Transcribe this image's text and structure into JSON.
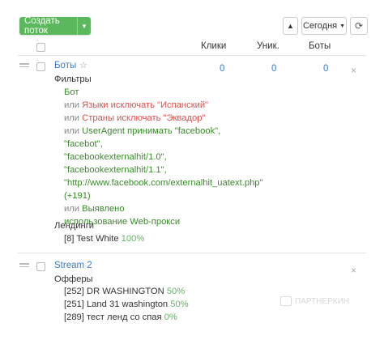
{
  "toolbar": {
    "create_label": "Создать поток",
    "period_label": "Сегодня"
  },
  "columns": {
    "clicks": "Клики",
    "unique": "Уник.",
    "bots": "Боты"
  },
  "streams": [
    {
      "name": "Боты",
      "clicks": "0",
      "unique": "0",
      "bots": "0",
      "filters_title": "Фильтры",
      "filters": {
        "first": "Бот",
        "or": "или",
        "lang": "Языки исключать \"Испанский\"",
        "country": "Страны исключать \"Эквадор\"",
        "ua1": "UserAgent принимать \"facebook\",",
        "ua2": "\"facebot\",",
        "ua3": "\"facebookexternalhit/1.0\",",
        "ua4": "\"facebookexternalhit/1.1\",",
        "ua5": "\"http://www.facebook.com/externalhit_uatext.php\"",
        "ua6": "(+191)",
        "detect1": "Выявлено",
        "detect2": "использование Web-прокси"
      },
      "landings_title": "Лендинги",
      "landing": {
        "id": "[8] Test White",
        "pct": "100%"
      }
    },
    {
      "name": "Stream 2",
      "offers_title": "Офферы",
      "offers": [
        {
          "id": "[252] DR WASHINGTON",
          "pct": "50%"
        },
        {
          "id": "[251] Land 31 washington",
          "pct": "50%"
        },
        {
          "id": "[289] тест ленд со спая",
          "pct": "0%"
        }
      ]
    }
  ],
  "watermark": "ПАРТНЕРКИН"
}
